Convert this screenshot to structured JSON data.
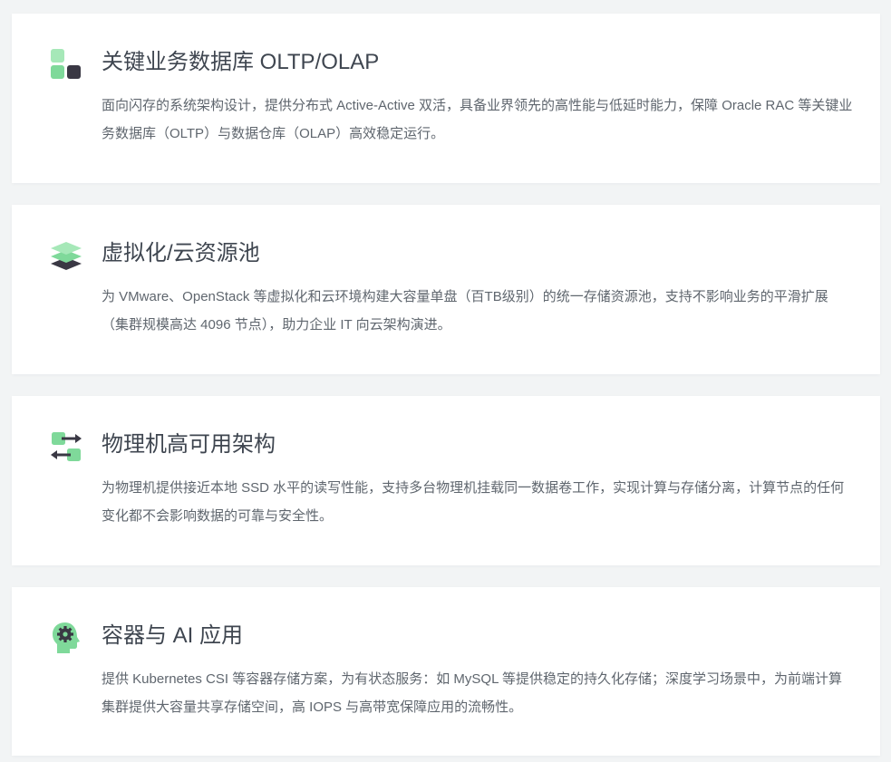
{
  "colors": {
    "accent_green": "#7fd99a",
    "icon_dark": "#3a3844",
    "title": "#3f4650",
    "text": "#5f666e",
    "background": "#f2f4f5",
    "card": "#ffffff"
  },
  "cards": [
    {
      "icon": "database-blocks-icon",
      "title": "关键业务数据库 OLTP/OLAP",
      "description": "面向闪存的系统架构设计，提供分布式 Active-Active 双活，具备业界领先的高性能与低延时能力，保障 Oracle RAC 等关键业务数据库（OLTP）与数据仓库（OLAP）高效稳定运行。"
    },
    {
      "icon": "layers-stack-icon",
      "title": "虚拟化/云资源池",
      "description": "为 VMware、OpenStack 等虚拟化和云环境构建大容量单盘（百TB级别）的统一存储资源池，支持不影响业务的平滑扩展（集群规模高达 4096 节点），助力企业 IT 向云架构演进。"
    },
    {
      "icon": "swap-arrows-icon",
      "title": "物理机高可用架构",
      "description": "为物理机提供接近本地 SSD 水平的读写性能，支持多台物理机挂载同一数据卷工作，实现计算与存储分离，计算节点的任何变化都不会影响数据的可靠与安全性。"
    },
    {
      "icon": "ai-head-gear-icon",
      "title": "容器与 AI 应用",
      "description": "提供 Kubernetes CSI 等容器存储方案，为有状态服务：如 MySQL 等提供稳定的持久化存储；深度学习场景中，为前端计算集群提供大容量共享存储空间，高 IOPS 与高带宽保障应用的流畅性。"
    }
  ]
}
